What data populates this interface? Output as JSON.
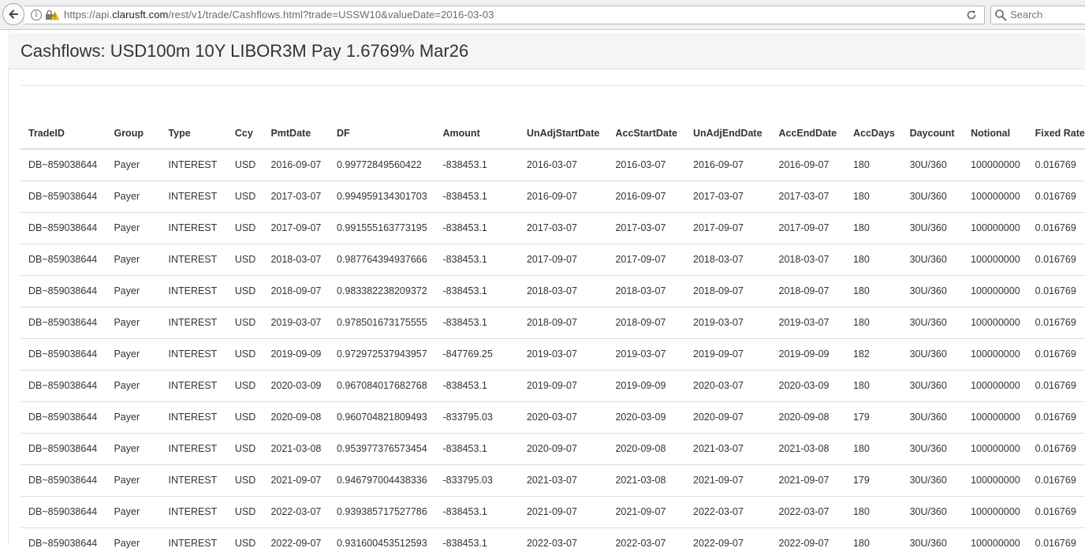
{
  "browser": {
    "url_prefix": "https://api.",
    "url_host": "clarusft.com",
    "url_path": "/rest/v1/trade/Cashflows.html?trade=USSW10&valueDate=2016-03-03",
    "search_placeholder": "Search"
  },
  "page": {
    "title": "Cashflows: USD100m 10Y LIBOR3M Pay 1.6769% Mar26"
  },
  "table": {
    "columns": [
      "TradeID",
      "Group",
      "Type",
      "Ccy",
      "PmtDate",
      "DF",
      "Amount",
      "UnAdjStartDate",
      "AccStartDate",
      "UnAdjEndDate",
      "AccEndDate",
      "AccDays",
      "Daycount",
      "Notional",
      "Fixed Rate"
    ],
    "rows": [
      [
        "DB~859038644",
        "Payer",
        "INTEREST",
        "USD",
        "2016-09-07",
        "0.99772849560422",
        "-838453.1",
        "2016-03-07",
        "2016-03-07",
        "2016-09-07",
        "2016-09-07",
        "180",
        "30U/360",
        "100000000",
        "0.016769"
      ],
      [
        "DB~859038644",
        "Payer",
        "INTEREST",
        "USD",
        "2017-03-07",
        "0.994959134301703",
        "-838453.1",
        "2016-09-07",
        "2016-09-07",
        "2017-03-07",
        "2017-03-07",
        "180",
        "30U/360",
        "100000000",
        "0.016769"
      ],
      [
        "DB~859038644",
        "Payer",
        "INTEREST",
        "USD",
        "2017-09-07",
        "0.991555163773195",
        "-838453.1",
        "2017-03-07",
        "2017-03-07",
        "2017-09-07",
        "2017-09-07",
        "180",
        "30U/360",
        "100000000",
        "0.016769"
      ],
      [
        "DB~859038644",
        "Payer",
        "INTEREST",
        "USD",
        "2018-03-07",
        "0.987764394937666",
        "-838453.1",
        "2017-09-07",
        "2017-09-07",
        "2018-03-07",
        "2018-03-07",
        "180",
        "30U/360",
        "100000000",
        "0.016769"
      ],
      [
        "DB~859038644",
        "Payer",
        "INTEREST",
        "USD",
        "2018-09-07",
        "0.983382238209372",
        "-838453.1",
        "2018-03-07",
        "2018-03-07",
        "2018-09-07",
        "2018-09-07",
        "180",
        "30U/360",
        "100000000",
        "0.016769"
      ],
      [
        "DB~859038644",
        "Payer",
        "INTEREST",
        "USD",
        "2019-03-07",
        "0.978501673175555",
        "-838453.1",
        "2018-09-07",
        "2018-09-07",
        "2019-03-07",
        "2019-03-07",
        "180",
        "30U/360",
        "100000000",
        "0.016769"
      ],
      [
        "DB~859038644",
        "Payer",
        "INTEREST",
        "USD",
        "2019-09-09",
        "0.972972537943957",
        "-847769.25",
        "2019-03-07",
        "2019-03-07",
        "2019-09-07",
        "2019-09-09",
        "182",
        "30U/360",
        "100000000",
        "0.016769"
      ],
      [
        "DB~859038644",
        "Payer",
        "INTEREST",
        "USD",
        "2020-03-09",
        "0.967084017682768",
        "-838453.1",
        "2019-09-07",
        "2019-09-09",
        "2020-03-07",
        "2020-03-09",
        "180",
        "30U/360",
        "100000000",
        "0.016769"
      ],
      [
        "DB~859038644",
        "Payer",
        "INTEREST",
        "USD",
        "2020-09-08",
        "0.960704821809493",
        "-833795.03",
        "2020-03-07",
        "2020-03-09",
        "2020-09-07",
        "2020-09-08",
        "179",
        "30U/360",
        "100000000",
        "0.016769"
      ],
      [
        "DB~859038644",
        "Payer",
        "INTEREST",
        "USD",
        "2021-03-08",
        "0.953977376573454",
        "-838453.1",
        "2020-09-07",
        "2020-09-08",
        "2021-03-07",
        "2021-03-08",
        "180",
        "30U/360",
        "100000000",
        "0.016769"
      ],
      [
        "DB~859038644",
        "Payer",
        "INTEREST",
        "USD",
        "2021-09-07",
        "0.946797004438336",
        "-833795.03",
        "2021-03-07",
        "2021-03-08",
        "2021-09-07",
        "2021-09-07",
        "179",
        "30U/360",
        "100000000",
        "0.016769"
      ],
      [
        "DB~859038644",
        "Payer",
        "INTEREST",
        "USD",
        "2022-03-07",
        "0.939385717527786",
        "-838453.1",
        "2021-09-07",
        "2021-09-07",
        "2022-03-07",
        "2022-03-07",
        "180",
        "30U/360",
        "100000000",
        "0.016769"
      ],
      [
        "DB~859038644",
        "Payer",
        "INTEREST",
        "USD",
        "2022-09-07",
        "0.931600453512593",
        "-838453.1",
        "2022-03-07",
        "2022-03-07",
        "2022-09-07",
        "2022-09-07",
        "180",
        "30U/360",
        "100000000",
        "0.016769"
      ]
    ]
  }
}
